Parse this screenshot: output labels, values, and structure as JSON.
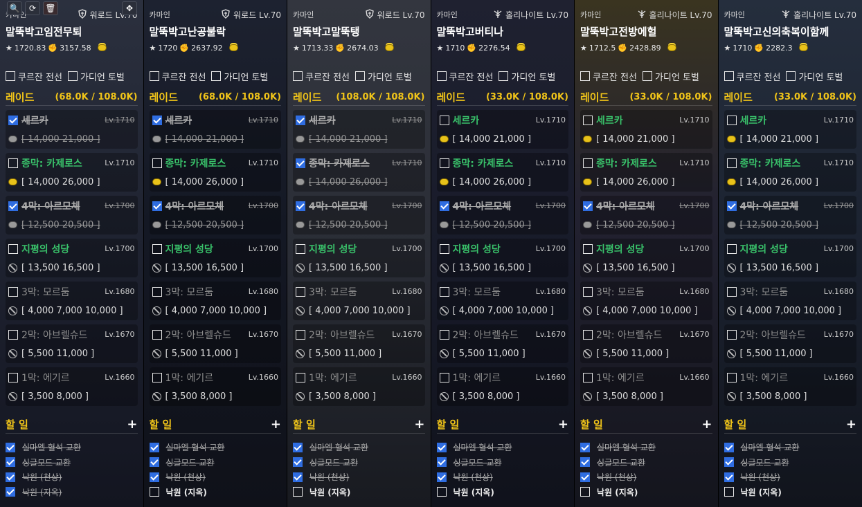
{
  "toolbar": {
    "zoom_icon": "zoom-icon",
    "refresh_icon": "refresh-icon",
    "delete_icon": "trash-icon",
    "move_icon": "move-icon"
  },
  "labels": {
    "raid": "레이드",
    "todo": "할 일",
    "plus": "+",
    "top_checks": [
      "쿠르잔 전선",
      "가디언 토벌"
    ]
  },
  "characters": [
    {
      "server": "카마인",
      "class": "워로드 Lv.70",
      "class_icon": "shield-icon",
      "name": "말뚝박고임전무퇴",
      "item_level": "1720.83",
      "combat_power": "3157.58",
      "gold_progress": "(68.0K / 108.0K)",
      "raids": [
        {
          "name": "세르카",
          "level": "Lv.1710",
          "checked": true,
          "state": "done",
          "gold": "[ 14,000  21,000 ]",
          "icon": "gold"
        },
        {
          "name": "종막: 카제로스",
          "level": "Lv.1710",
          "checked": false,
          "state": "open",
          "gold": "[ 14,000  26,000 ]",
          "icon": "gold"
        },
        {
          "name": "4막: 아르모체",
          "level": "Lv.1700",
          "checked": true,
          "state": "done",
          "gold": "[ 12,500  20,500 ]",
          "icon": "gold"
        },
        {
          "name": "지평의 성당",
          "level": "Lv.1700",
          "checked": false,
          "state": "open",
          "gold": "[ 13,500  16,500 ]",
          "icon": "ban"
        },
        {
          "name": "3막: 모르둠",
          "level": "Lv.1680",
          "checked": false,
          "state": "dim",
          "gold": "[ 4,000  7,000  10,000 ]",
          "icon": "ban"
        },
        {
          "name": "2막: 아브렐슈드",
          "level": "Lv.1670",
          "checked": false,
          "state": "dim",
          "gold": "[ 5,500  11,000 ]",
          "icon": "ban"
        },
        {
          "name": "1막: 에기르",
          "level": "Lv.1660",
          "checked": false,
          "state": "dim",
          "gold": "[ 3,500  8,000 ]",
          "icon": "ban"
        }
      ],
      "todos": [
        {
          "label": "실마엘 혈석 교환",
          "checked": true
        },
        {
          "label": "싱글모드 교환",
          "checked": true
        },
        {
          "label": "낙원 (천상)",
          "checked": true
        },
        {
          "label": "낙원 (지옥)",
          "checked": true
        }
      ]
    },
    {
      "server": "카마인",
      "class": "워로드 Lv.70",
      "class_icon": "shield-icon",
      "name": "말뚝박고난공불락",
      "item_level": "1720",
      "combat_power": "2637.92",
      "gold_progress": "(68.0K / 108.0K)",
      "raids": [
        {
          "name": "세르카",
          "level": "Lv.1710",
          "checked": true,
          "state": "done",
          "gold": "[ 14,000  21,000 ]",
          "icon": "gold"
        },
        {
          "name": "종막: 카제로스",
          "level": "Lv.1710",
          "checked": false,
          "state": "open",
          "gold": "[ 14,000  26,000 ]",
          "icon": "gold"
        },
        {
          "name": "4막: 아르모체",
          "level": "Lv.1700",
          "checked": true,
          "state": "done",
          "gold": "[ 12,500  20,500 ]",
          "icon": "gold"
        },
        {
          "name": "지평의 성당",
          "level": "Lv.1700",
          "checked": false,
          "state": "open",
          "gold": "[ 13,500  16,500 ]",
          "icon": "ban"
        },
        {
          "name": "3막: 모르둠",
          "level": "Lv.1680",
          "checked": false,
          "state": "dim",
          "gold": "[ 4,000  7,000  10,000 ]",
          "icon": "ban"
        },
        {
          "name": "2막: 아브렐슈드",
          "level": "Lv.1670",
          "checked": false,
          "state": "dim",
          "gold": "[ 5,500  11,000 ]",
          "icon": "ban"
        },
        {
          "name": "1막: 에기르",
          "level": "Lv.1660",
          "checked": false,
          "state": "dim",
          "gold": "[ 3,500  8,000 ]",
          "icon": "ban"
        }
      ],
      "todos": [
        {
          "label": "실마엘 혈석 교환",
          "checked": true
        },
        {
          "label": "싱글모드 교환",
          "checked": true
        },
        {
          "label": "낙원 (천상)",
          "checked": true
        },
        {
          "label": "낙원 (지옥)",
          "checked": false
        }
      ]
    },
    {
      "server": "카마인",
      "class": "워로드 Lv.70",
      "class_icon": "shield-icon",
      "name": "말뚝박고말뚝탱",
      "item_level": "1713.33",
      "combat_power": "2674.03",
      "gold_progress": "(108.0K / 108.0K)",
      "raids": [
        {
          "name": "세르카",
          "level": "Lv.1710",
          "checked": true,
          "state": "done",
          "gold": "[ 14,000  21,000 ]",
          "icon": "gold"
        },
        {
          "name": "종막: 카제로스",
          "level": "Lv.1710",
          "checked": true,
          "state": "done",
          "gold": "[ 14,000  26,000 ]",
          "icon": "gold"
        },
        {
          "name": "4막: 아르모체",
          "level": "Lv.1700",
          "checked": true,
          "state": "done",
          "gold": "[ 12,500  20,500 ]",
          "icon": "gold"
        },
        {
          "name": "지평의 성당",
          "level": "Lv.1700",
          "checked": false,
          "state": "open",
          "gold": "[ 13,500  16,500 ]",
          "icon": "ban"
        },
        {
          "name": "3막: 모르둠",
          "level": "Lv.1680",
          "checked": false,
          "state": "dim",
          "gold": "[ 4,000  7,000  10,000 ]",
          "icon": "ban"
        },
        {
          "name": "2막: 아브렐슈드",
          "level": "Lv.1670",
          "checked": false,
          "state": "dim",
          "gold": "[ 5,500  11,000 ]",
          "icon": "ban"
        },
        {
          "name": "1막: 에기르",
          "level": "Lv.1660",
          "checked": false,
          "state": "dim",
          "gold": "[ 3,500  8,000 ]",
          "icon": "ban"
        }
      ],
      "todos": [
        {
          "label": "실마엘 혈석 교환",
          "checked": true
        },
        {
          "label": "싱글모드 교환",
          "checked": true
        },
        {
          "label": "낙원 (천상)",
          "checked": true
        },
        {
          "label": "낙원 (지옥)",
          "checked": false
        }
      ]
    },
    {
      "server": "카마인",
      "class": "홀리나이트 Lv.70",
      "class_icon": "wings-icon",
      "name": "말뚝박고버티나",
      "item_level": "1710",
      "combat_power": "2276.54",
      "gold_progress": "(33.0K / 108.0K)",
      "raids": [
        {
          "name": "세르카",
          "level": "Lv.1710",
          "checked": false,
          "state": "open",
          "gold": "[ 14,000  21,000 ]",
          "icon": "gold"
        },
        {
          "name": "종막: 카제로스",
          "level": "Lv.1710",
          "checked": false,
          "state": "open",
          "gold": "[ 14,000  26,000 ]",
          "icon": "gold"
        },
        {
          "name": "4막: 아르모체",
          "level": "Lv.1700",
          "checked": true,
          "state": "done",
          "gold": "[ 12,500  20,500 ]",
          "icon": "gold"
        },
        {
          "name": "지평의 성당",
          "level": "Lv.1700",
          "checked": false,
          "state": "open",
          "gold": "[ 13,500  16,500 ]",
          "icon": "ban"
        },
        {
          "name": "3막: 모르둠",
          "level": "Lv.1680",
          "checked": false,
          "state": "dim",
          "gold": "[ 4,000  7,000  10,000 ]",
          "icon": "ban"
        },
        {
          "name": "2막: 아브렐슈드",
          "level": "Lv.1670",
          "checked": false,
          "state": "dim",
          "gold": "[ 5,500  11,000 ]",
          "icon": "ban"
        },
        {
          "name": "1막: 에기르",
          "level": "Lv.1660",
          "checked": false,
          "state": "dim",
          "gold": "[ 3,500  8,000 ]",
          "icon": "ban"
        }
      ],
      "todos": [
        {
          "label": "실마엘 혈석 교환",
          "checked": true
        },
        {
          "label": "싱글모드 교환",
          "checked": true
        },
        {
          "label": "낙원 (천상)",
          "checked": true
        },
        {
          "label": "낙원 (지옥)",
          "checked": false
        }
      ]
    },
    {
      "server": "카마인",
      "class": "홀리나이트 Lv.70",
      "class_icon": "wings-icon",
      "name": "말뚝박고전방에헐",
      "item_level": "1712.5",
      "combat_power": "2428.89",
      "gold_progress": "(33.0K / 108.0K)",
      "raids": [
        {
          "name": "세르카",
          "level": "Lv.1710",
          "checked": false,
          "state": "open",
          "gold": "[ 14,000  21,000 ]",
          "icon": "gold"
        },
        {
          "name": "종막: 카제로스",
          "level": "Lv.1710",
          "checked": false,
          "state": "open",
          "gold": "[ 14,000  26,000 ]",
          "icon": "gold"
        },
        {
          "name": "4막: 아르모체",
          "level": "Lv.1700",
          "checked": true,
          "state": "done",
          "gold": "[ 12,500  20,500 ]",
          "icon": "gold"
        },
        {
          "name": "지평의 성당",
          "level": "Lv.1700",
          "checked": false,
          "state": "open",
          "gold": "[ 13,500  16,500 ]",
          "icon": "ban"
        },
        {
          "name": "3막: 모르둠",
          "level": "Lv.1680",
          "checked": false,
          "state": "dim",
          "gold": "[ 4,000  7,000  10,000 ]",
          "icon": "ban"
        },
        {
          "name": "2막: 아브렐슈드",
          "level": "Lv.1670",
          "checked": false,
          "state": "dim",
          "gold": "[ 5,500  11,000 ]",
          "icon": "ban"
        },
        {
          "name": "1막: 에기르",
          "level": "Lv.1660",
          "checked": false,
          "state": "dim",
          "gold": "[ 3,500  8,000 ]",
          "icon": "ban"
        }
      ],
      "todos": [
        {
          "label": "실마엘 혈석 교환",
          "checked": true
        },
        {
          "label": "싱글모드 교환",
          "checked": true
        },
        {
          "label": "낙원 (천상)",
          "checked": true
        },
        {
          "label": "낙원 (지옥)",
          "checked": false
        }
      ]
    },
    {
      "server": "카마인",
      "class": "홀리나이트 Lv.70",
      "class_icon": "wings-icon",
      "name": "말뚝박고신의축복이함께",
      "item_level": "1710",
      "combat_power": "2282.3",
      "gold_progress": "(33.0K / 108.0K)",
      "raids": [
        {
          "name": "세르카",
          "level": "Lv.1710",
          "checked": false,
          "state": "open",
          "gold": "[ 14,000  21,000 ]",
          "icon": "gold"
        },
        {
          "name": "종막: 카제로스",
          "level": "Lv.1710",
          "checked": false,
          "state": "open",
          "gold": "[ 14,000  26,000 ]",
          "icon": "gold"
        },
        {
          "name": "4막: 아르모체",
          "level": "Lv.1700",
          "checked": true,
          "state": "done",
          "gold": "[ 12,500  20,500 ]",
          "icon": "gold"
        },
        {
          "name": "지평의 성당",
          "level": "Lv.1700",
          "checked": false,
          "state": "open",
          "gold": "[ 13,500  16,500 ]",
          "icon": "ban"
        },
        {
          "name": "3막: 모르둠",
          "level": "Lv.1680",
          "checked": false,
          "state": "dim",
          "gold": "[ 4,000  7,000  10,000 ]",
          "icon": "ban"
        },
        {
          "name": "2막: 아브렐슈드",
          "level": "Lv.1670",
          "checked": false,
          "state": "dim",
          "gold": "[ 5,500  11,000 ]",
          "icon": "ban"
        },
        {
          "name": "1막: 에기르",
          "level": "Lv.1660",
          "checked": false,
          "state": "dim",
          "gold": "[ 3,500  8,000 ]",
          "icon": "ban"
        }
      ],
      "todos": [
        {
          "label": "실마엘 혈석 교환",
          "checked": true
        },
        {
          "label": "싱글모드 교환",
          "checked": true
        },
        {
          "label": "낙원 (천상)",
          "checked": true
        },
        {
          "label": "낙원 (지옥)",
          "checked": false
        }
      ]
    }
  ]
}
